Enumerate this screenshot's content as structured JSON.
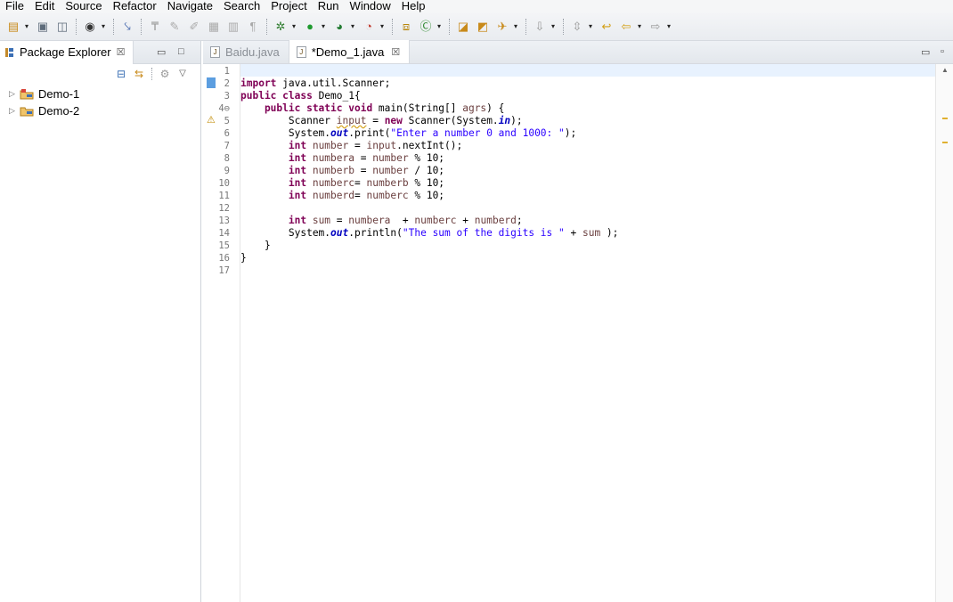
{
  "menu": [
    "File",
    "Edit",
    "Source",
    "Refactor",
    "Navigate",
    "Search",
    "Project",
    "Run",
    "Window",
    "Help"
  ],
  "package_explorer": {
    "title": "Package Explorer",
    "close_glyph": "☒",
    "minimize_glyph": "▭",
    "maximize_glyph": "□",
    "projects": [
      {
        "name": "Demo-1"
      },
      {
        "name": "Demo-2"
      }
    ]
  },
  "editor": {
    "tabs": [
      {
        "label": "Baidu.java",
        "active": false
      },
      {
        "label": "*Demo_1.java",
        "active": true
      }
    ],
    "close_glyph": "☒",
    "line_numbers": [
      "1",
      "2",
      "3",
      "4⊖",
      "5",
      "6",
      "7",
      "8",
      "9",
      "10",
      "11",
      "12",
      "13",
      "14",
      "15",
      "16",
      "17"
    ],
    "code": {
      "l2_a": "import ",
      "l2_b": "java.util.Scanner;",
      "l3_a": "public class ",
      "l3_b": "Demo_1{",
      "l4_a": "    public static void ",
      "l4_b": "main(String[] ",
      "l4_c": "agrs",
      "l4_d": ") {",
      "l5_a": "        Scanner ",
      "l5_b": "input",
      "l5_c": " = ",
      "l5_d": "new ",
      "l5_e": "Scanner(System.",
      "l5_f": "in",
      "l5_g": ");",
      "l6_a": "        System.",
      "l6_b": "out",
      "l6_c": ".print(",
      "l6_d": "\"Enter a number 0 and 1000: \"",
      "l6_e": ");",
      "l7_a": "        int ",
      "l7_b": "number",
      "l7_c": " = ",
      "l7_d": "input",
      "l7_e": ".nextInt();",
      "l8_a": "        int ",
      "l8_b": "numbera",
      "l8_c": " = ",
      "l8_d": "number",
      "l8_e": " % 10;",
      "l9_a": "        int ",
      "l9_b": "numberb",
      "l9_c": " = ",
      "l9_d": "number",
      "l9_e": " / 10;",
      "l10_a": "        int ",
      "l10_b": "numberc",
      "l10_c": "= ",
      "l10_d": "numberb",
      "l10_e": " % 10;",
      "l11_a": "        int ",
      "l11_b": "numberd",
      "l11_c": "= ",
      "l11_d": "numberc",
      "l11_e": " % 10;",
      "l13_a": "        int ",
      "l13_b": "sum",
      "l13_c": " = ",
      "l13_d": "numbera",
      "l13_e": "  + ",
      "l13_f": "numberc",
      "l13_g": " + ",
      "l13_h": "numberd",
      "l13_i": ";",
      "l14_a": "        System.",
      "l14_b": "out",
      "l14_c": ".println(",
      "l14_d": "\"The sum of the digits is \"",
      "l14_e": " + ",
      "l14_f": "sum",
      "l14_g": " );",
      "l15": "    }",
      "l16": "}"
    }
  },
  "colors": {
    "keyword": "#7f0055",
    "string": "#2a00ff",
    "field": "#0000c0",
    "variable": "#6a3e3e",
    "current_line": "#e8f2fe"
  }
}
